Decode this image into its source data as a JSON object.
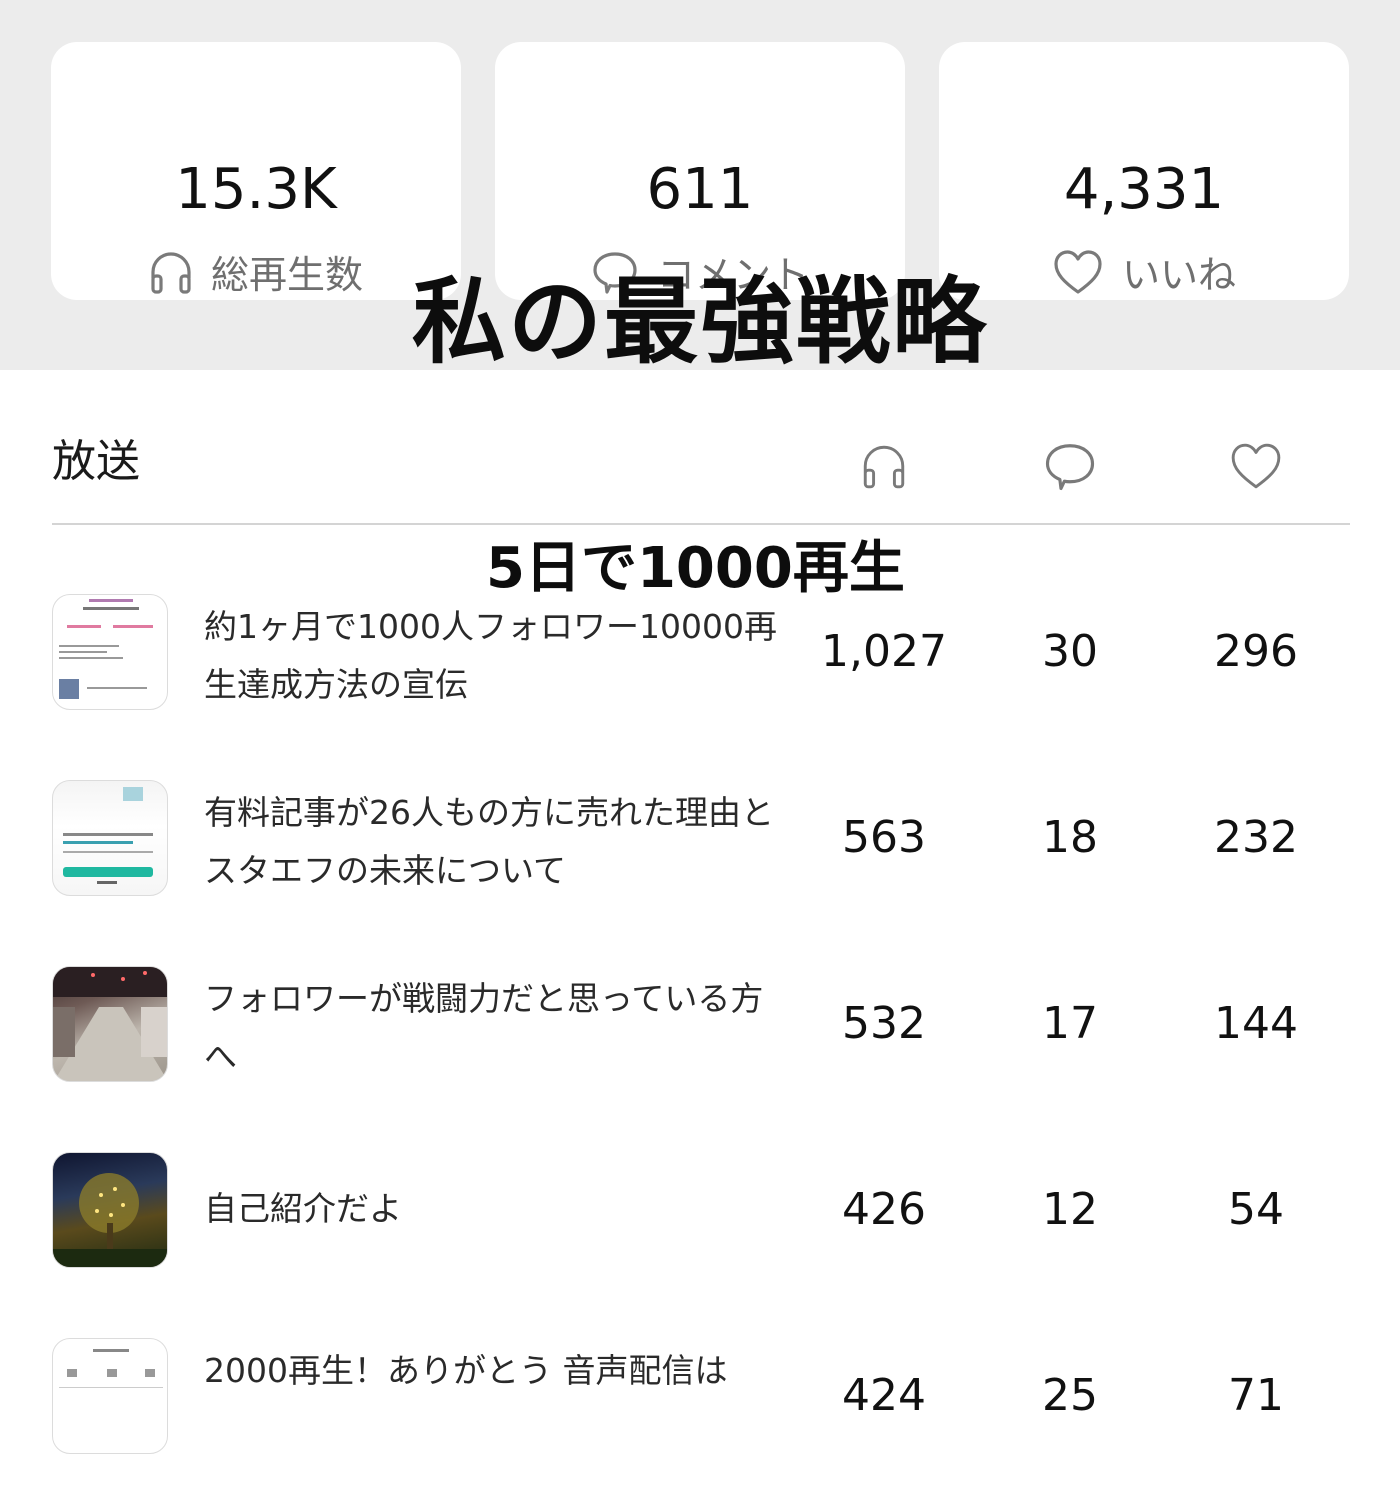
{
  "stats": [
    {
      "value": "15.3K",
      "label": "総再生数",
      "icon": "headphones-icon"
    },
    {
      "value": "611",
      "label": "コメント",
      "icon": "comment-icon"
    },
    {
      "value": "4,331",
      "label": "いいね",
      "icon": "heart-icon"
    }
  ],
  "overlay": {
    "title": "私の最強戦略",
    "subtitle": "5日で1000再生"
  },
  "table": {
    "header_label": "放送",
    "column_icons": [
      "headphones-icon",
      "comment-icon",
      "heart-icon"
    ]
  },
  "episodes": [
    {
      "title": "約1ヶ月で1000人フォロワー10000再生達成方法の宣伝",
      "plays": "1,027",
      "comments": "30",
      "likes": "296"
    },
    {
      "title": "有料記事が26人もの方に売れた理由とスタエフの未来について",
      "plays": "563",
      "comments": "18",
      "likes": "232"
    },
    {
      "title": "フォロワーが戦闘力だと思っている方へ",
      "plays": "532",
      "comments": "17",
      "likes": "144"
    },
    {
      "title": "自己紹介だよ",
      "plays": "426",
      "comments": "12",
      "likes": "54"
    },
    {
      "title": "2000再生！ありがとう 音声配信は",
      "plays": "424",
      "comments": "25",
      "likes": "71"
    }
  ],
  "colors": {
    "top_background": "#ececec",
    "card_background": "#ffffff",
    "icon_gray": "#7a7a7a",
    "text_dark": "#111111",
    "divider": "#d4d4d4"
  }
}
